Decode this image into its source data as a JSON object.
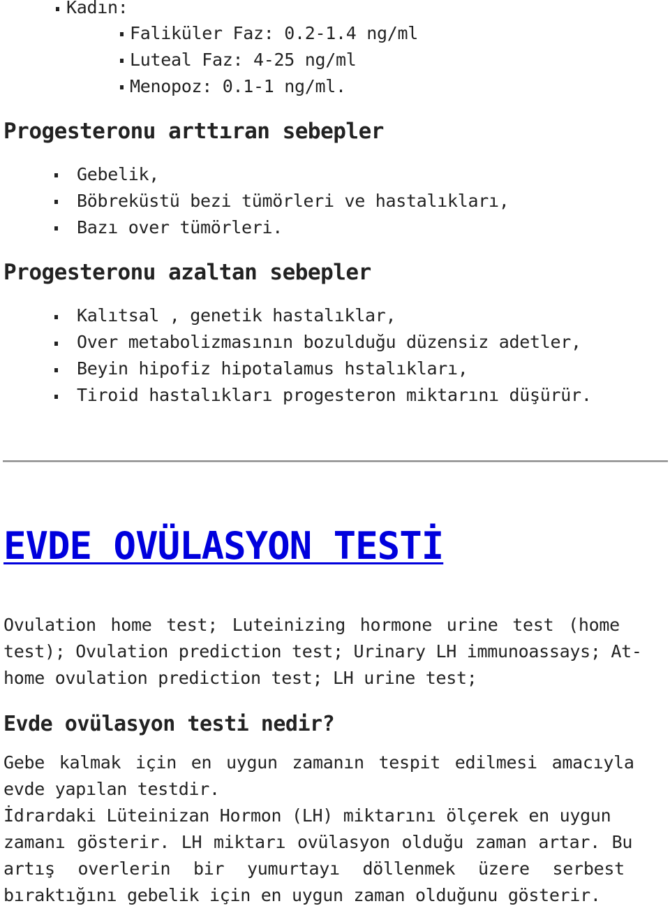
{
  "reference_values": {
    "female_label": "Kadın:",
    "phases": [
      "Faliküler Faz: 0.2-1.4 ng/ml",
      "Luteal Faz: 4-25 ng/ml",
      "Menopoz: 0.1-1 ng/ml."
    ]
  },
  "increase_section": {
    "heading": "Progesteronu arttıran sebepler",
    "items": [
      "Gebelik,",
      "Böbreküstü bezi tümörleri ve hastalıkları,",
      "Bazı over tümörleri."
    ]
  },
  "decrease_section": {
    "heading": "Progesteronu azaltan sebepler",
    "items": [
      "Kalıtsal , genetik hastalıklar,",
      "Over metabolizmasının bozulduğu düzensiz adetler,",
      "Beyin hipofiz hipotalamus hstalıkları,",
      "Tiroid hastalıkları progesteron miktarını düşürür."
    ]
  },
  "ovulation_section": {
    "title_link": "EVDE OVÜLASYON TESTİ",
    "link_color": "#0000dd",
    "alt_names_lines": [
      "Ovulation home test; Luteinizing hormone urine test (home",
      "test); Ovulation prediction test; Urinary LH immunoassays; At-",
      "home ovulation prediction test; LH urine test;"
    ],
    "subheading": "Evde ovülasyon testi nedir?",
    "paragraph_1_lines": [
      "Gebe kalmak için en uygun zamanın tespit edilmesi amacıyla",
      "evde yapılan testdir."
    ],
    "paragraph_2_lines": [
      "İdrardaki Lüteinizan Hormon (LH) miktarını ölçerek en uygun",
      "zamanı gösterir. LH miktarı ovülasyon olduğu zaman artar. Bu",
      "artış overlerin bir yumurtayı döllenmek üzere serbest",
      "bıraktığını gebelik için en uygun zaman olduğunu gösterir."
    ]
  }
}
